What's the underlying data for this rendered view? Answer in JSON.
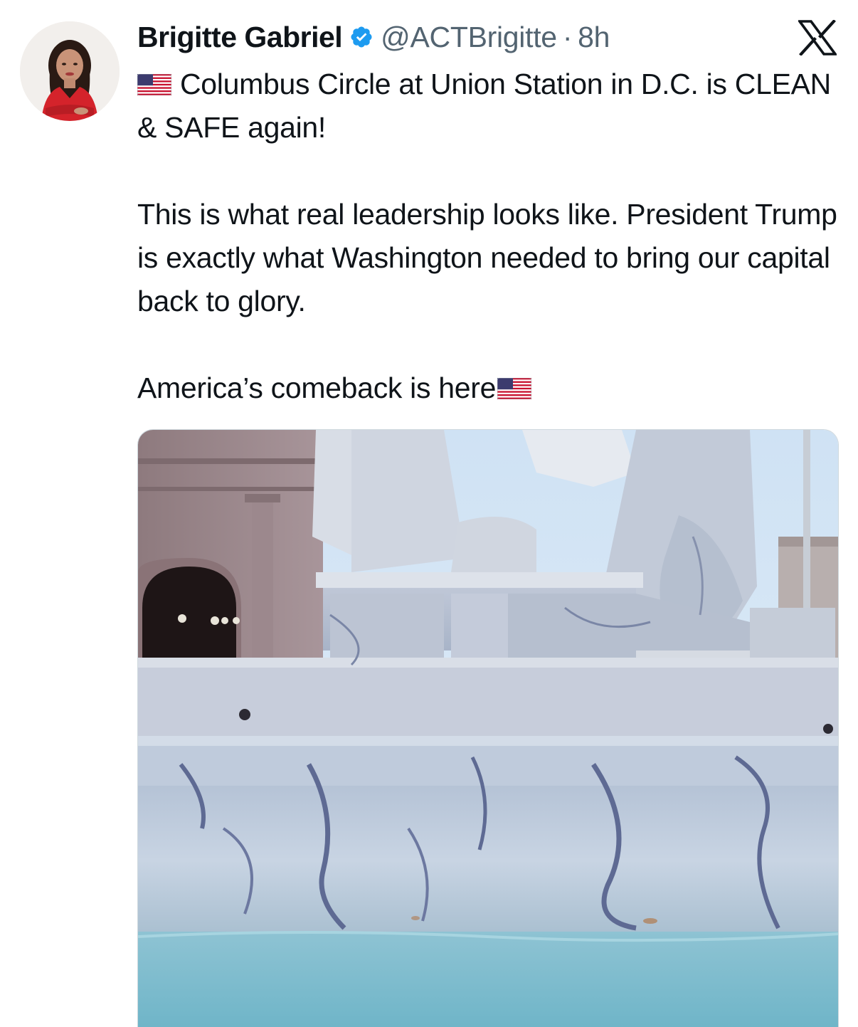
{
  "author": {
    "display_name": "Brigitte Gabriel",
    "handle": "@ACTBrigitte",
    "separator": "·",
    "time": "8h",
    "verified": true,
    "verified_color": "#1d9bf0",
    "avatar_icon": "profile-photo"
  },
  "platform": {
    "logo_icon": "x-logo-icon"
  },
  "tweet": {
    "line1_flag": "us-flag-emoji",
    "paragraph1": "Columbus Circle at Union Station in D.C. is CLEAN & SAFE again!",
    "paragraph2": "This is what real leadership looks like. President Trump is exactly what Washington needed to bring our capital back to glory.",
    "paragraph3": "America’s comeback is here",
    "paragraph3_flag": "us-flag-emoji"
  },
  "media": {
    "kind": "video-thumbnail",
    "subject": "marble fountain statue"
  },
  "colors": {
    "text_primary": "#0f1419",
    "text_secondary": "#536471",
    "accent": "#1d9bf0"
  }
}
